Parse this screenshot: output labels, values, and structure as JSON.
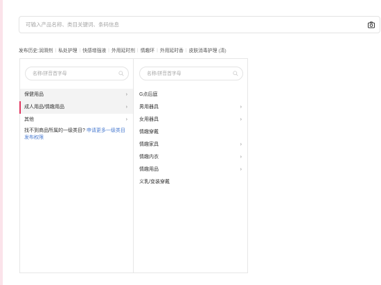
{
  "search": {
    "placeholder": "可输入产品名称、类目关键词、条码信息",
    "value": ""
  },
  "history": {
    "label": "发布历史:",
    "items": [
      "润滑剂",
      "私处护理",
      "快感增强液",
      "外用延时剂",
      "情趣环",
      "外用延时香",
      "皮肤消毒护理"
    ],
    "clear_label": "(清)"
  },
  "column1": {
    "filter_placeholder": "名称/拼音首字母",
    "items": [
      {
        "label": "保健用品",
        "arrow": "›"
      },
      {
        "label": "成人用品/情趣用品",
        "arrow": "›"
      },
      {
        "label": "其他",
        "arrow": "›"
      }
    ],
    "notice_text": "找不到商品所属的一级类目?",
    "notice_link": "申请更多一级类目发布权限"
  },
  "column2": {
    "filter_placeholder": "名称/拼音首字母",
    "items": [
      {
        "label": "G点后庭",
        "arrow": ""
      },
      {
        "label": "男用器具",
        "arrow": "›"
      },
      {
        "label": "女用器具",
        "arrow": "›"
      },
      {
        "label": "情趣穿戴",
        "arrow": ""
      },
      {
        "label": "情趣家具",
        "arrow": "›"
      },
      {
        "label": "情趣内衣",
        "arrow": "›"
      },
      {
        "label": "情趣用品",
        "arrow": "›"
      },
      {
        "label": "义乳/变装穿戴",
        "arrow": ""
      }
    ]
  },
  "colors": {
    "accent": "#e0325c",
    "link": "#4a7bd0"
  }
}
